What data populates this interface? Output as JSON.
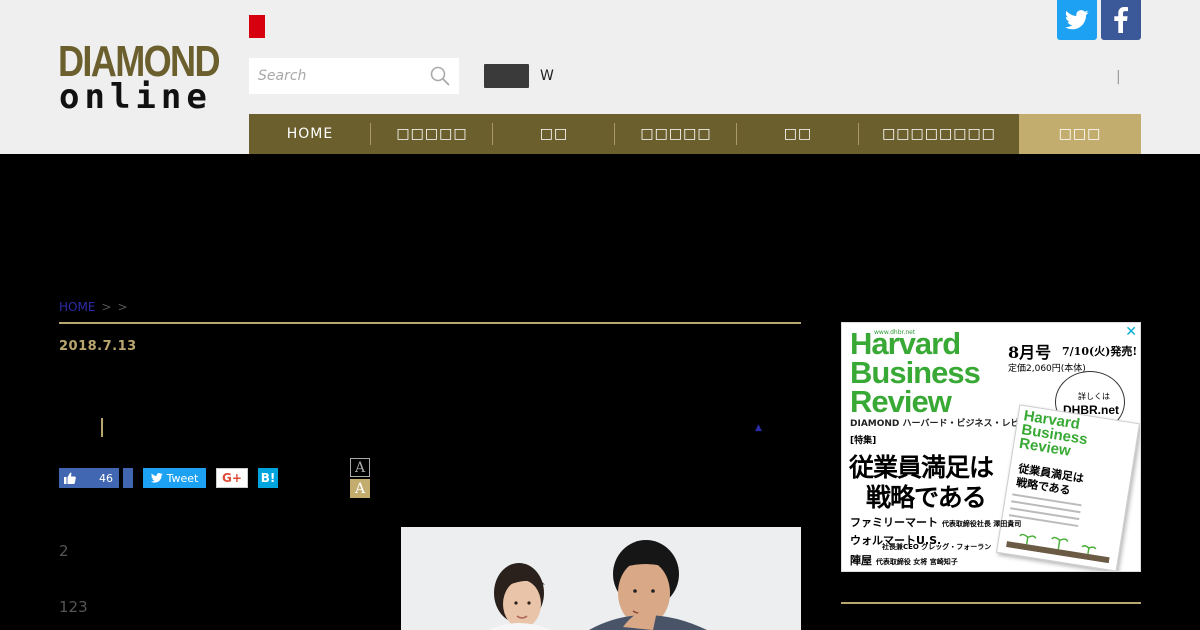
{
  "header": {
    "logo_line1": "DIAMOND",
    "logo_line2": "online",
    "search_placeholder": "Search",
    "w_label": "W",
    "pipe": "|"
  },
  "nav": {
    "items": [
      {
        "label": "HOME"
      },
      {
        "label": "□□□□□"
      },
      {
        "label": "□□"
      },
      {
        "label": "□□□□□"
      },
      {
        "label": "□□"
      },
      {
        "label": "□□□□□□□□"
      },
      {
        "label": "□□□"
      }
    ]
  },
  "breadcrumb": {
    "home": "HOME",
    "sep1": ">",
    "sep2": ">"
  },
  "article": {
    "date": "2018.7.13",
    "para1": "2",
    "para2": "123"
  },
  "share": {
    "like_count": "46",
    "tweet_label": "Tweet",
    "gplus_label": "G+",
    "hatena_label": "B!"
  },
  "font_size": {
    "small": "A",
    "large": "A"
  },
  "ad": {
    "url": "www.dhbr.net",
    "brand": "Harvard\nBusiness\nReview",
    "sub": "DIAMOND ハーバード・ビジネス・レビュー",
    "issue": "8月号",
    "release": "7/10(火)発売!",
    "price": "定価2,060円(本体)",
    "detail": "詳しくは",
    "site": "DHBR.net",
    "tokushu": "[特集]",
    "headline1": "従業員満足は",
    "headline2": "戦略である",
    "line1_main": "ファミリーマート",
    "line1_small": "代表取締役社長 澤田貴司",
    "line2_main": "ウォルマートU.S.",
    "line2_small": "社長兼CEO グレッグ・フォーラン",
    "line3_main": "陣屋",
    "line3_small": "代表取締役 女将 宮崎知子",
    "mini_brand": "Harvard\nBusiness\nReview",
    "mini_headline": "従業員満足は\n戦略である",
    "close": "✕"
  },
  "colors": {
    "brand_gold": "#6b5f2e",
    "accent_gold": "#b9a66e",
    "nav_active": "#c2ad6e",
    "twitter": "#1da1f2",
    "facebook": "#3b5998",
    "hbr_green": "#39a935"
  }
}
